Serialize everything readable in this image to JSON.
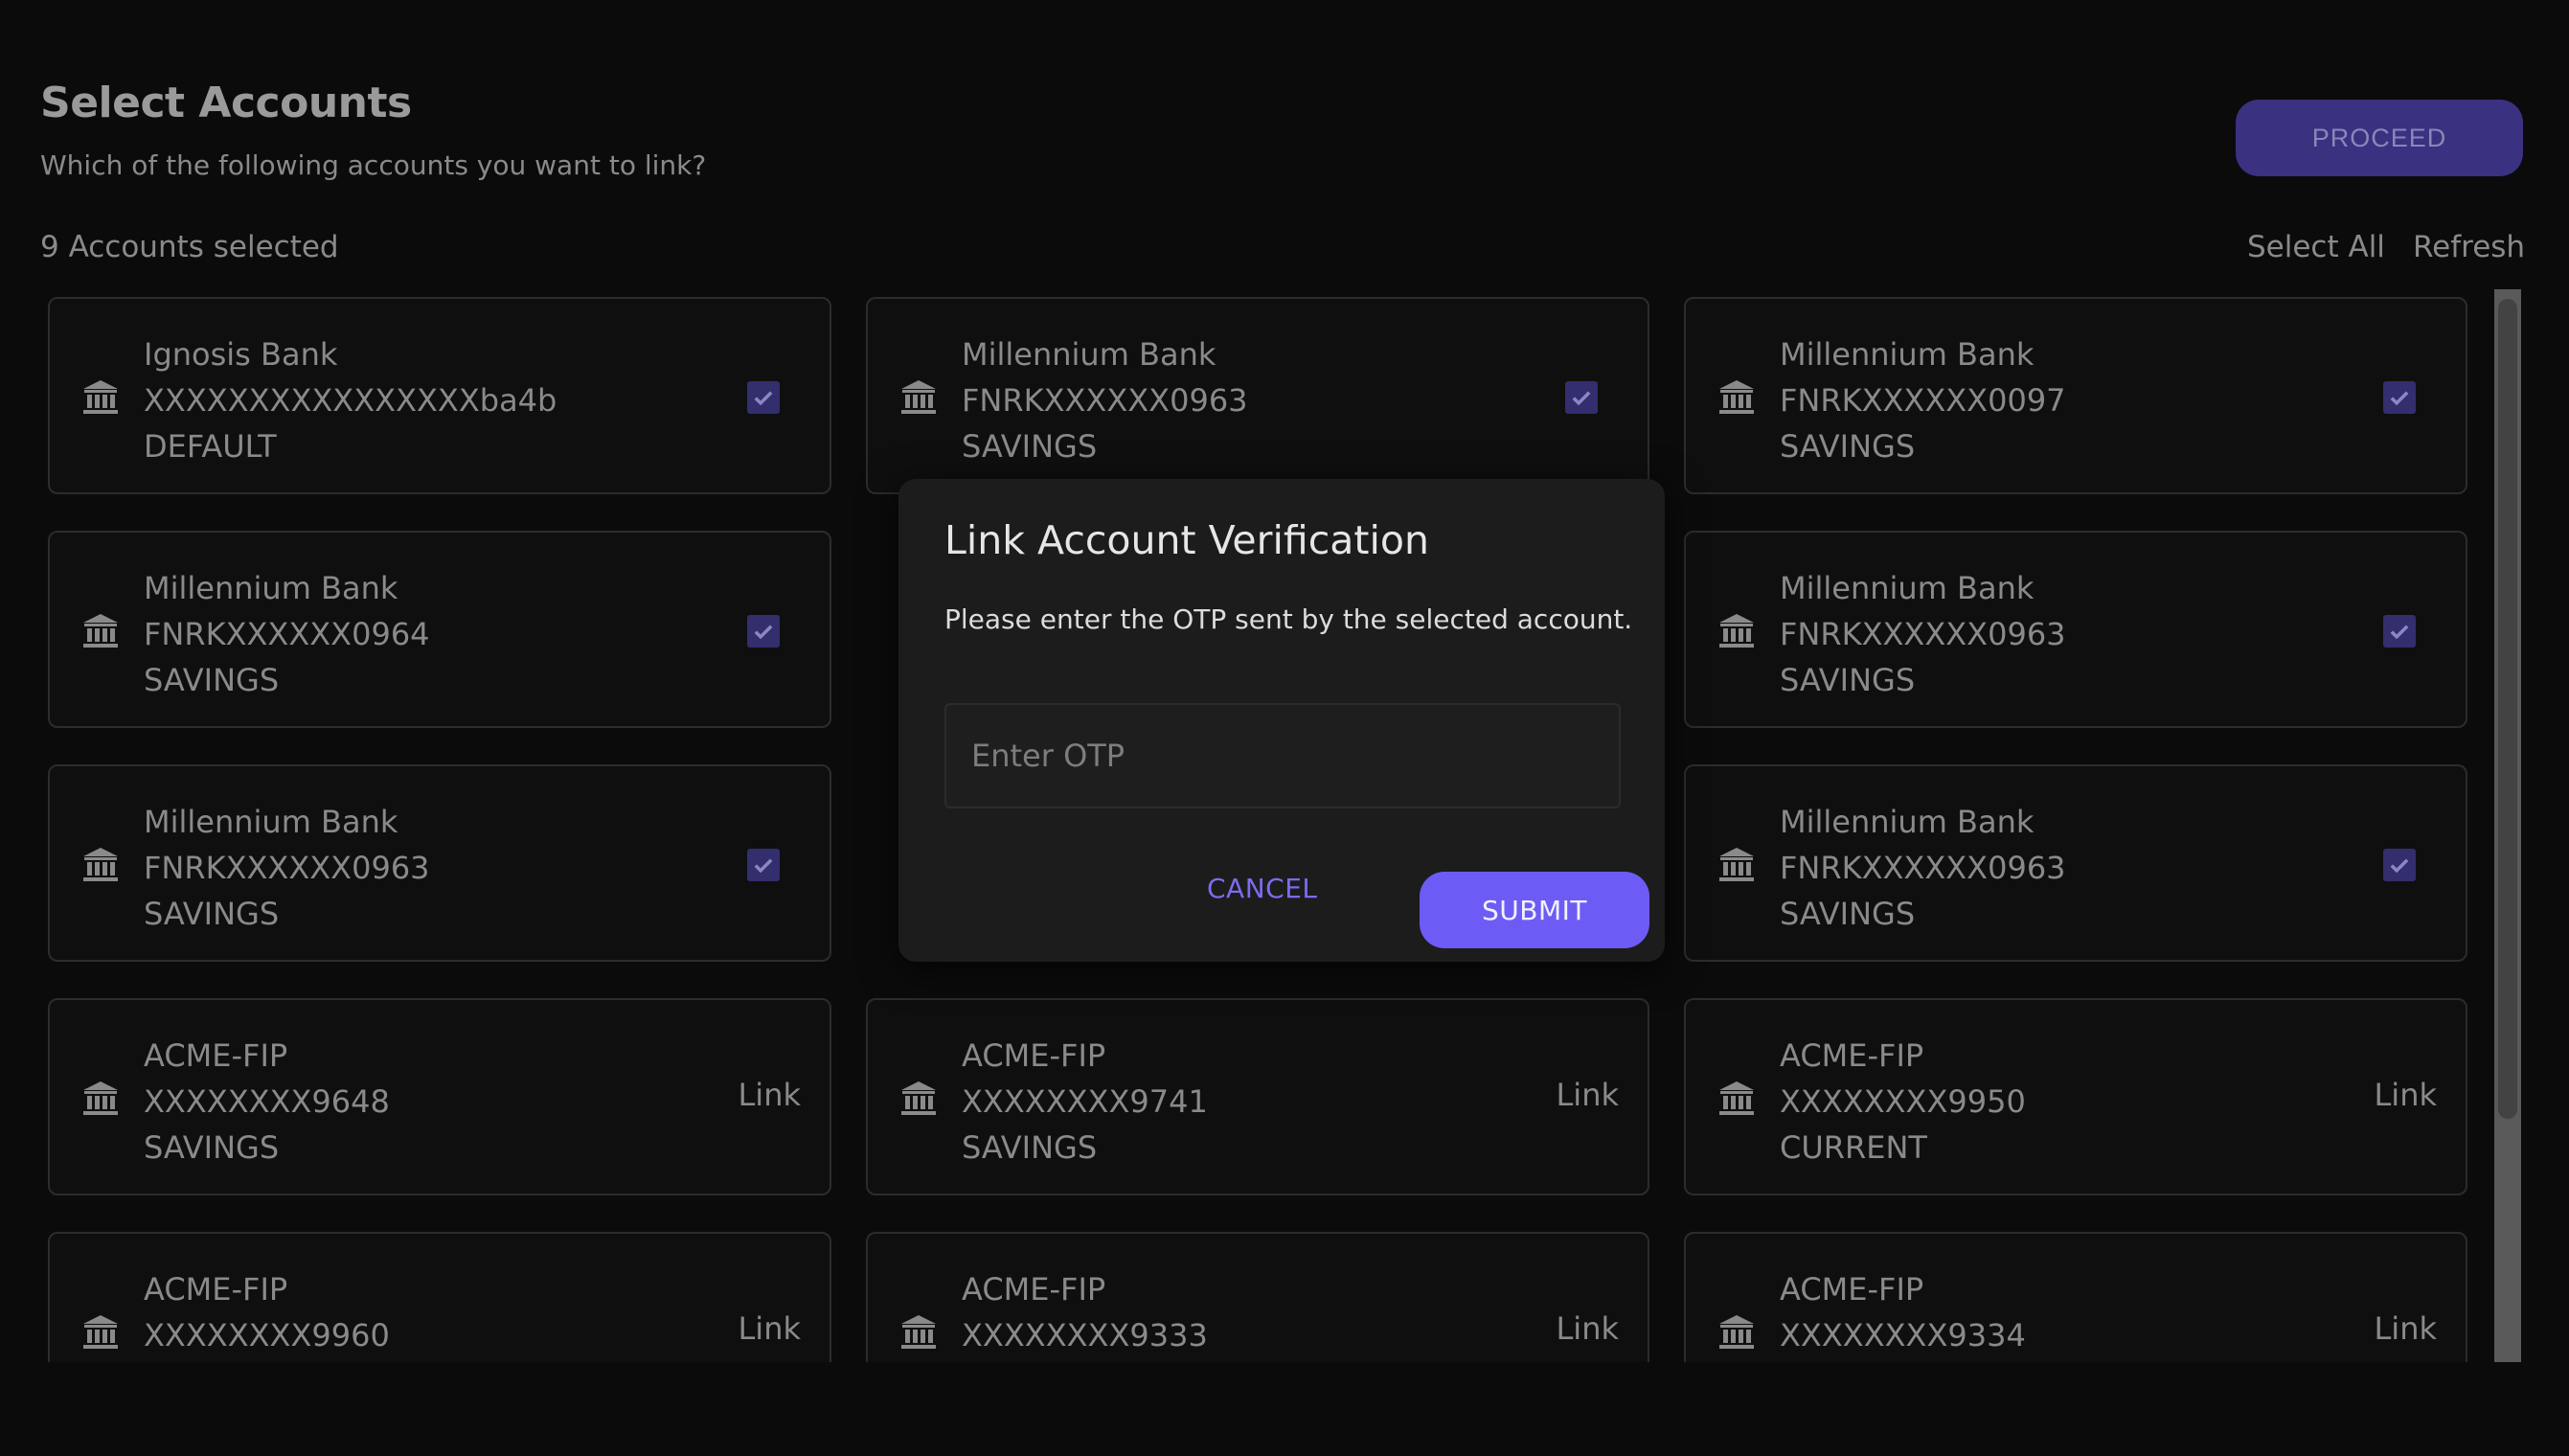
{
  "header": {
    "title": "Select Accounts",
    "subtitle": "Which of the following accounts you want to link?",
    "proceed_label": "PROCEED"
  },
  "toolbar": {
    "selected_count": "9 Accounts selected",
    "select_all_label": "Select All",
    "refresh_label": "Refresh"
  },
  "accounts": [
    {
      "bank": "Ignosis Bank",
      "number": "XXXXXXXXXXXXXXXXba4b",
      "type": "DEFAULT",
      "status": "checked"
    },
    {
      "bank": "Millennium Bank",
      "number": "FNRKXXXXXX0963",
      "type": "SAVINGS",
      "status": "checked"
    },
    {
      "bank": "Millennium Bank",
      "number": "FNRKXXXXXX0097",
      "type": "SAVINGS",
      "status": "checked"
    },
    {
      "bank": "Millennium Bank",
      "number": "FNRKXXXXXX0964",
      "type": "SAVINGS",
      "status": "checked"
    },
    {
      "bank": "",
      "number": "",
      "type": "",
      "status": "hidden"
    },
    {
      "bank": "Millennium Bank",
      "number": "FNRKXXXXXX0963",
      "type": "SAVINGS",
      "status": "checked"
    },
    {
      "bank": "Millennium Bank",
      "number": "FNRKXXXXXX0963",
      "type": "SAVINGS",
      "status": "checked"
    },
    {
      "bank": "",
      "number": "",
      "type": "",
      "status": "hidden"
    },
    {
      "bank": "Millennium Bank",
      "number": "FNRKXXXXXX0963",
      "type": "SAVINGS",
      "status": "checked"
    },
    {
      "bank": "ACME-FIP",
      "number": "XXXXXXXX9648",
      "type": "SAVINGS",
      "status": "link",
      "link_label": "Link"
    },
    {
      "bank": "ACME-FIP",
      "number": "XXXXXXXX9741",
      "type": "SAVINGS",
      "status": "link",
      "link_label": "Link"
    },
    {
      "bank": "ACME-FIP",
      "number": "XXXXXXXX9950",
      "type": "CURRENT",
      "status": "link",
      "link_label": "Link"
    },
    {
      "bank": "ACME-FIP",
      "number": "XXXXXXXX9960",
      "type": "",
      "status": "link",
      "link_label": "Link"
    },
    {
      "bank": "ACME-FIP",
      "number": "XXXXXXXX9333",
      "type": "",
      "status": "link",
      "link_label": "Link"
    },
    {
      "bank": "ACME-FIP",
      "number": "XXXXXXXX9334",
      "type": "",
      "status": "link",
      "link_label": "Link"
    }
  ],
  "dialog": {
    "title": "Link Account Verification",
    "message": "Please enter the OTP sent by the selected account.",
    "otp_placeholder": "Enter OTP",
    "otp_value": "",
    "cancel_label": "CANCEL",
    "submit_label": "SUBMIT"
  },
  "icons": {
    "bank": "bank-icon",
    "checkbox": "checkbox-checked-icon"
  },
  "colors": {
    "accent": "#6c5cf5",
    "proceed_bg": "#3a3180",
    "checkbox_bg": "#332e6e"
  }
}
